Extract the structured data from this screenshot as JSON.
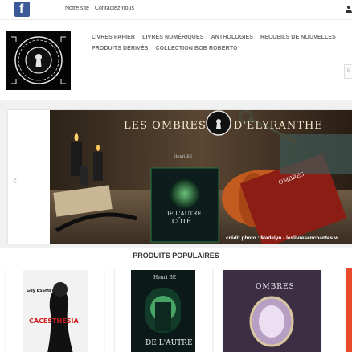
{
  "topbar": {
    "facebook_letter": "f",
    "links": [
      "Notre site",
      "Contactez-nous"
    ],
    "user_icon": "user-icon"
  },
  "logo": {
    "text": "LES OMBRES D'ELYRANTHE",
    "icon": "keyhole-icon"
  },
  "nav": {
    "row1": [
      "Livres papier",
      "Livres numériques",
      "Anthologies",
      "Recueils de nouvelles"
    ],
    "row2": [
      "Produits dérivés",
      "Collection Bob Roberto"
    ]
  },
  "search": {
    "placeholder": "R"
  },
  "hero": {
    "title_left": "LES OMBRES",
    "title_right": "D'ELYRANTHE",
    "credit": "crédit photo : Madelyn - leslivresenchantes.w",
    "prev_arrow": "‹",
    "book1": {
      "author": "Henri BE",
      "title1": "DE L'AUTRE",
      "title2": "CÔTÉ"
    },
    "book2": {
      "title": "OMBRES"
    }
  },
  "popular": {
    "title": "Produits populaires",
    "products": [
      {
        "cover_author": "Guy ESSMER",
        "cover_title": "CACESTHESIA"
      },
      {
        "cover_author": "Henri BE",
        "cover_title": "DE L'AUTRE CÔTÉ"
      },
      {
        "cover_title": "OMBRES"
      }
    ]
  },
  "colors": {
    "facebook": "#3b5998",
    "nav_text": "#6d6d6d",
    "accent_red": "#d21f1f"
  }
}
